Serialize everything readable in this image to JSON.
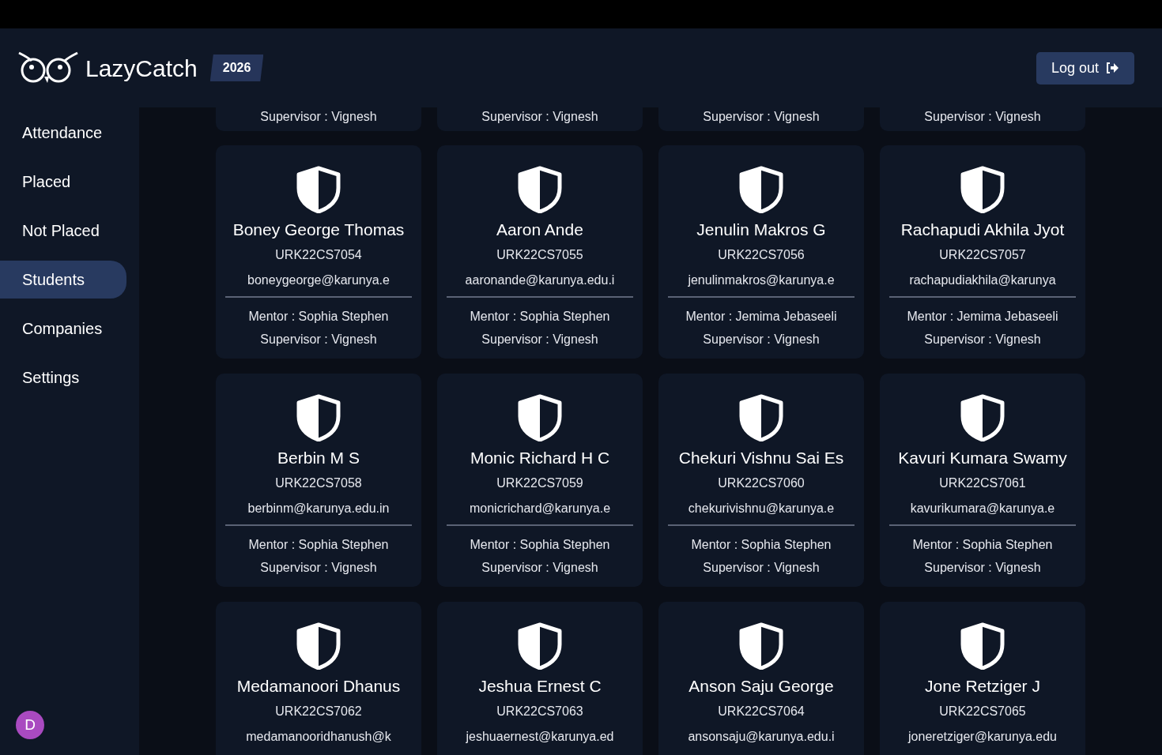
{
  "brand": {
    "name": "LazyCatch",
    "year": "2026"
  },
  "logout": {
    "label": "Log out"
  },
  "sidebar": {
    "items": [
      {
        "label": "Attendance",
        "selected": false
      },
      {
        "label": "Placed",
        "selected": false
      },
      {
        "label": "Not Placed",
        "selected": false
      },
      {
        "label": "Students",
        "selected": true
      },
      {
        "label": "Companies",
        "selected": false
      },
      {
        "label": "Settings",
        "selected": false
      }
    ],
    "avatar": {
      "initial": "D"
    }
  },
  "partial_cards": [
    {
      "supervisor": "Supervisor : Vignesh"
    },
    {
      "supervisor": "Supervisor : Vignesh"
    },
    {
      "supervisor": "Supervisor : Vignesh"
    },
    {
      "supervisor": "Supervisor : Vignesh"
    }
  ],
  "students": [
    {
      "name": "Boney George Thomas",
      "id": "URK22CS7054",
      "email": "boneygeorge@karunya.e",
      "mentor": "Mentor : Sophia Stephen",
      "supervisor": "Supervisor : Vignesh"
    },
    {
      "name": "Aaron Ande",
      "id": "URK22CS7055",
      "email": "aaronande@karunya.edu.i",
      "mentor": "Mentor : Sophia Stephen",
      "supervisor": "Supervisor : Vignesh"
    },
    {
      "name": "Jenulin Makros G",
      "id": "URK22CS7056",
      "email": "jenulinmakros@karunya.e",
      "mentor": "Mentor : Jemima Jebaseeli",
      "supervisor": "Supervisor : Vignesh"
    },
    {
      "name": "Rachapudi Akhila Jyot",
      "id": "URK22CS7057",
      "email": "rachapudiakhila@karunya",
      "mentor": "Mentor : Jemima Jebaseeli",
      "supervisor": "Supervisor : Vignesh"
    },
    {
      "name": "Berbin M S",
      "id": "URK22CS7058",
      "email": "berbinm@karunya.edu.in",
      "mentor": "Mentor : Sophia Stephen",
      "supervisor": "Supervisor : Vignesh"
    },
    {
      "name": "Monic Richard H C",
      "id": "URK22CS7059",
      "email": "monicrichard@karunya.e",
      "mentor": "Mentor : Sophia Stephen",
      "supervisor": "Supervisor : Vignesh"
    },
    {
      "name": "Chekuri Vishnu Sai Es",
      "id": "URK22CS7060",
      "email": "chekurivishnu@karunya.e",
      "mentor": "Mentor : Sophia Stephen",
      "supervisor": "Supervisor : Vignesh"
    },
    {
      "name": "Kavuri Kumara Swamy",
      "id": "URK22CS7061",
      "email": "kavurikumara@karunya.e",
      "mentor": "Mentor : Sophia Stephen",
      "supervisor": "Supervisor : Vignesh"
    },
    {
      "name": "Medamanoori Dhanus",
      "id": "URK22CS7062",
      "email": "medamanooridhanush@k"
    },
    {
      "name": "Jeshua Ernest C",
      "id": "URK22CS7063",
      "email": "jeshuaernest@karunya.ed"
    },
    {
      "name": "Anson Saju George",
      "id": "URK22CS7064",
      "email": "ansonsaju@karunya.edu.i"
    },
    {
      "name": "Jone Retziger J",
      "id": "URK22CS7065",
      "email": "joneretziger@karunya.edu"
    }
  ]
}
